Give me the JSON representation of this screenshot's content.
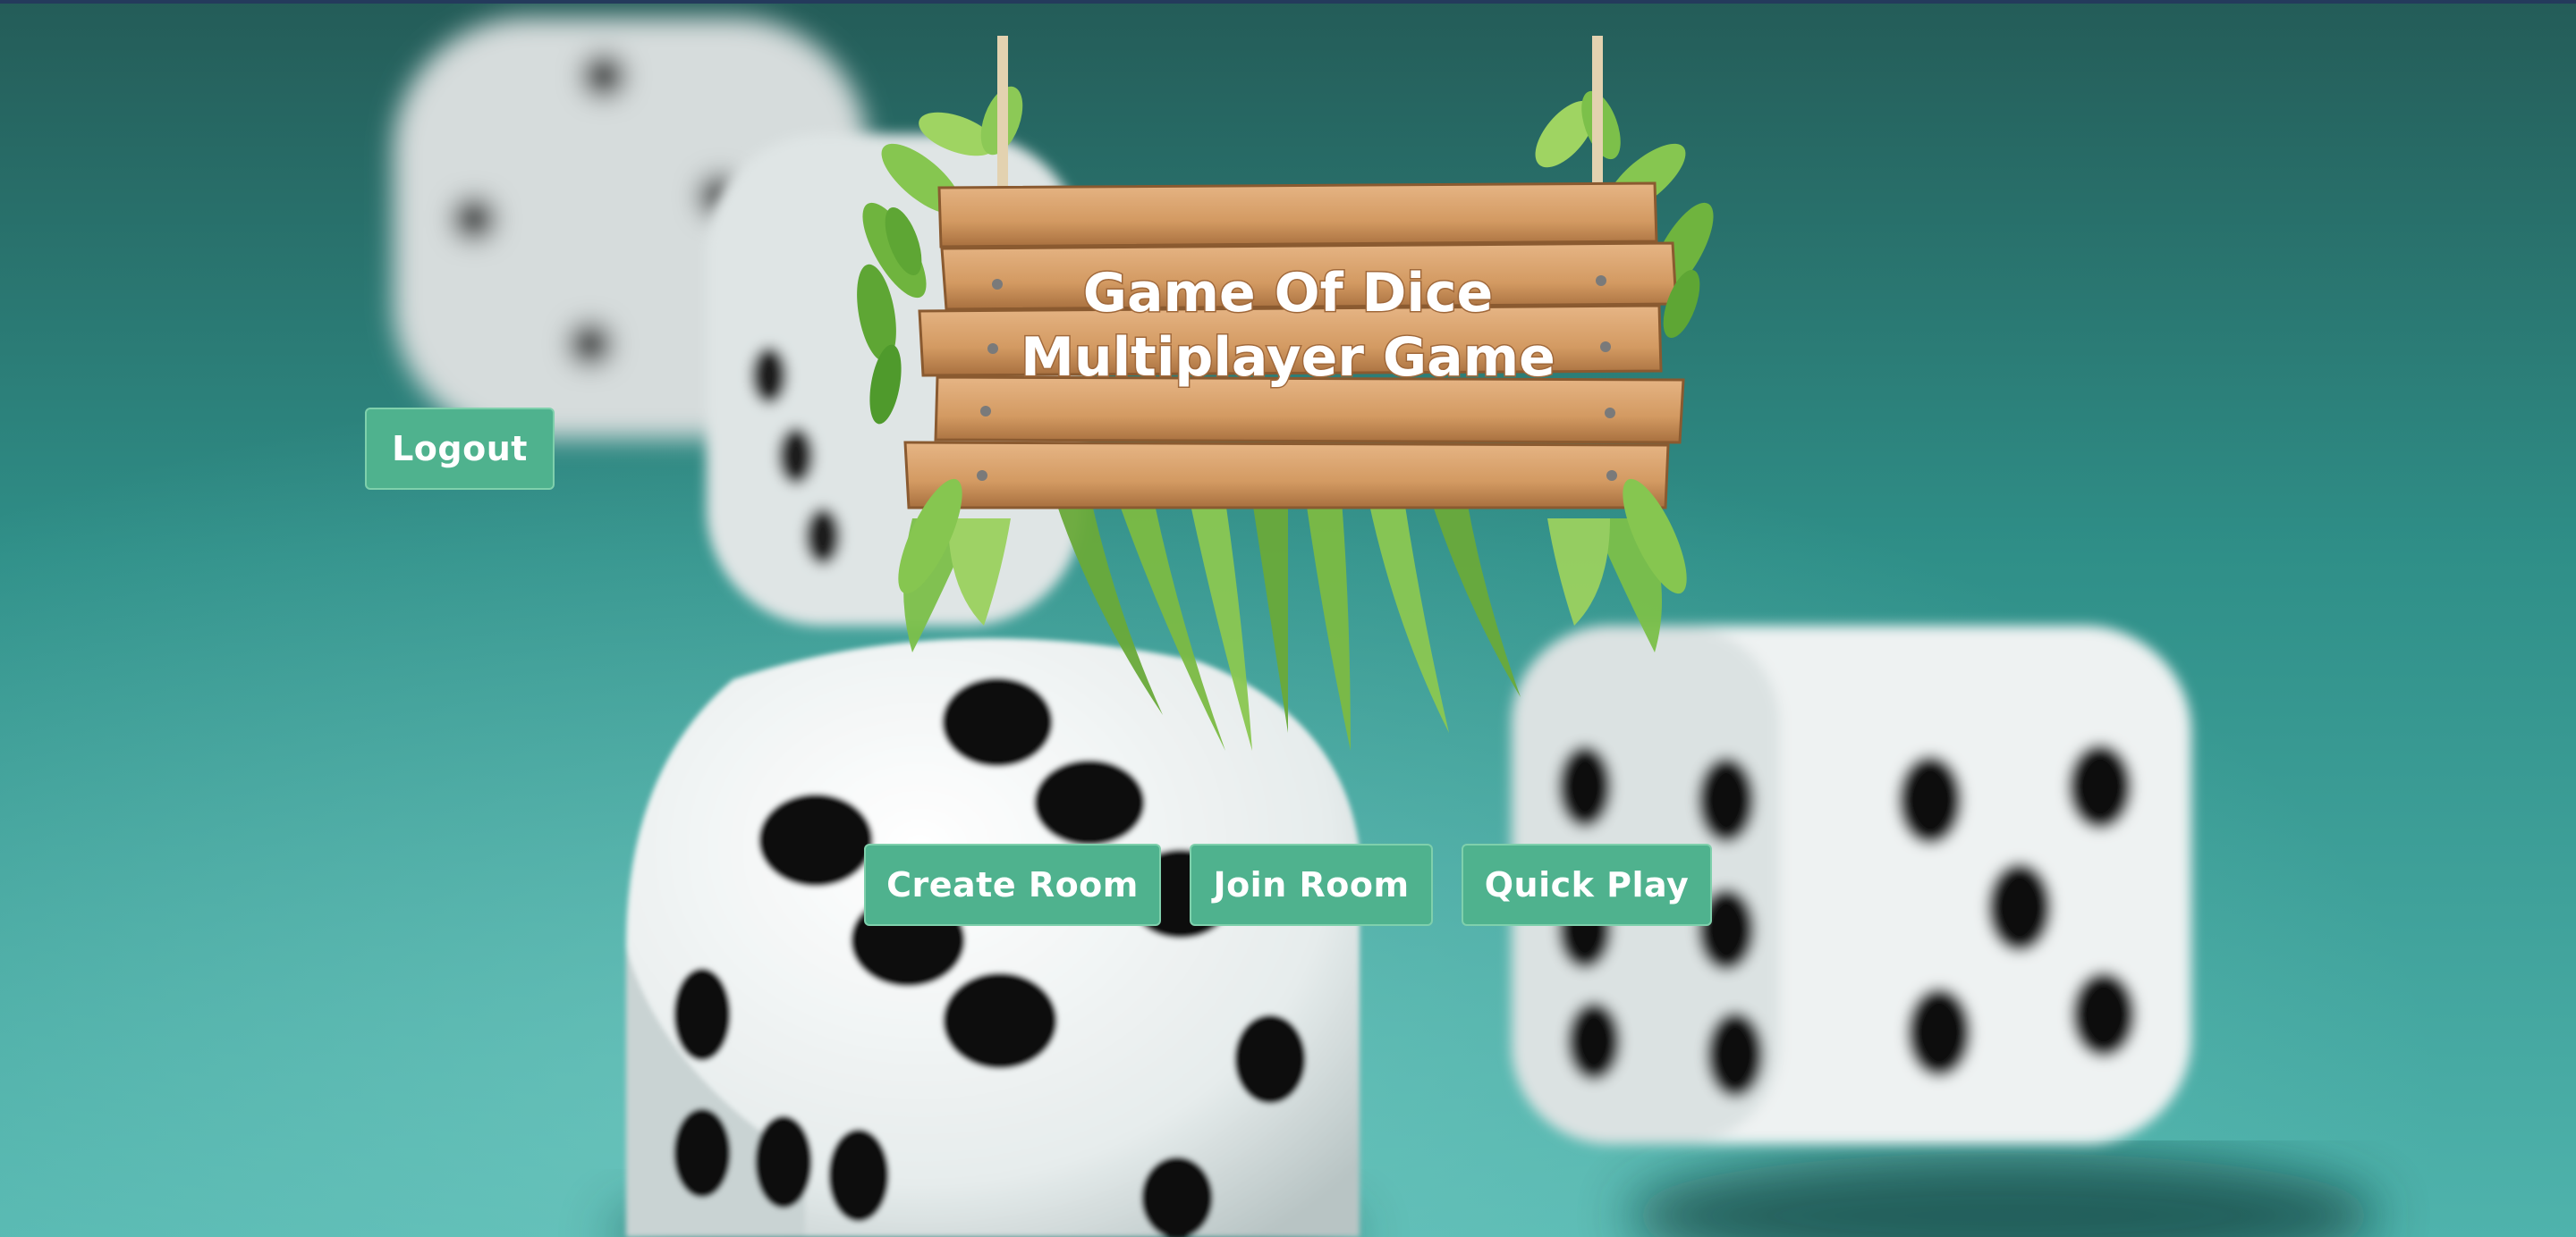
{
  "sign": {
    "line1": "Game Of Dice",
    "line2": "Multiplayer Game"
  },
  "buttons": {
    "logout": "Logout",
    "create_room": "Create Room",
    "join_room": "Join Room",
    "quick_play": "Quick Play"
  },
  "colors": {
    "button_bg": "#4fb28e",
    "button_border": "#7fd0ac",
    "felt_dark": "#245f5c",
    "felt_light": "#5dbdb5",
    "wood": "#d9a06a",
    "leaf": "#7cc04a"
  },
  "icons": [
    "dice-icon",
    "hanging-sign-icon",
    "leaf-decoration-icon"
  ]
}
